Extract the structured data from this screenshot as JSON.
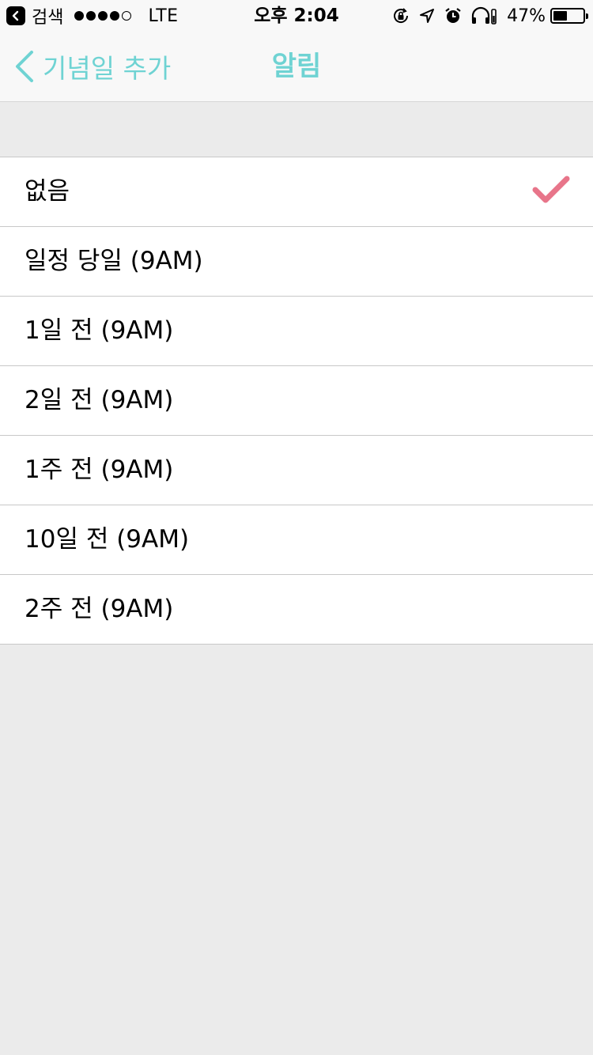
{
  "status_bar": {
    "carrier": "검색",
    "signal_filled": 4,
    "signal_total": 5,
    "network": "LTE",
    "time": "오후 2:04",
    "icons": [
      "orientation-lock-icon",
      "location-arrow-icon",
      "alarm-icon",
      "headphones-icon"
    ],
    "battery_percent": "47%",
    "battery_level": 0.47
  },
  "nav": {
    "back_label": "기념일 추가",
    "title": "알림",
    "accent_color": "#6fd3d3"
  },
  "options": [
    {
      "label": "없음",
      "selected": true
    },
    {
      "label": "일정 당일 (9AM)",
      "selected": false
    },
    {
      "label": "1일 전 (9AM)",
      "selected": false
    },
    {
      "label": "2일 전 (9AM)",
      "selected": false
    },
    {
      "label": "1주 전 (9AM)",
      "selected": false
    },
    {
      "label": "10일 전 (9AM)",
      "selected": false
    },
    {
      "label": "2주 전 (9AM)",
      "selected": false
    }
  ],
  "check_color": "#e8758a"
}
